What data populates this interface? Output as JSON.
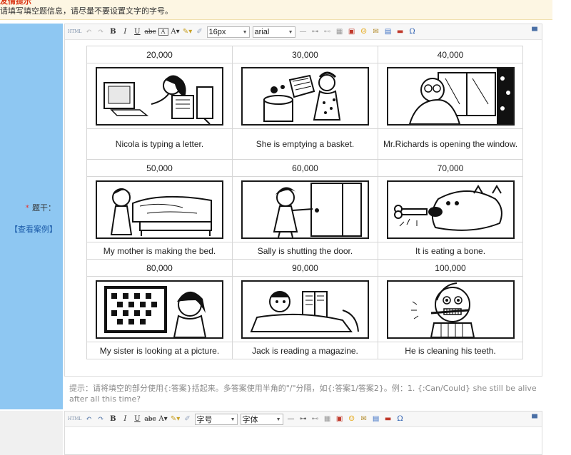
{
  "notice": {
    "title": "友情提示",
    "message": "请填写填空题信息，请尽量不要设置文字的字号。"
  },
  "field": {
    "required_mark": "*",
    "label": "题干：",
    "example_link": "【查看案例】"
  },
  "editor_toolbar": {
    "html_label": "HTML",
    "bold": "B",
    "italic": "I",
    "underline": "U",
    "strike": "abc",
    "font_size_value": "16px",
    "font_family_value": "arial",
    "font_color": "A",
    "text_format": "A"
  },
  "editor2_toolbar": {
    "font_size_value": "字号",
    "font_family_value": "字体"
  },
  "grid": {
    "rows": [
      {
        "prices": [
          "20,000",
          "30,000",
          "40,000"
        ],
        "pictures": [
          "computer-typing-illustration",
          "basket-emptying-illustration",
          "window-opening-illustration"
        ],
        "captions": [
          "Nicola is typing a letter.",
          "She is emptying a basket.",
          "Mr.Richards is opening the window."
        ]
      },
      {
        "prices": [
          "50,000",
          "60,000",
          "70,000"
        ],
        "pictures": [
          "bed-making-illustration",
          "door-shutting-illustration",
          "dog-bone-illustration"
        ],
        "captions": [
          "My mother is making the bed.",
          "Sally is shutting the door.",
          "It is eating a bone."
        ]
      },
      {
        "prices": [
          "80,000",
          "90,000",
          "100,000"
        ],
        "pictures": [
          "picture-looking-illustration",
          "magazine-reading-illustration",
          "teeth-cleaning-illustration"
        ],
        "captions": [
          "My sister is looking at a picture.",
          "Jack is reading a magazine.",
          "He is cleaning his teeth."
        ]
      }
    ]
  },
  "hint": "提示：请将填空的部分使用{:答案}括起来。多答案使用半角的\"/\"分隔，如{:答案1/答案2}。例：1. {:Can/Could} she still be alive after all this time?"
}
